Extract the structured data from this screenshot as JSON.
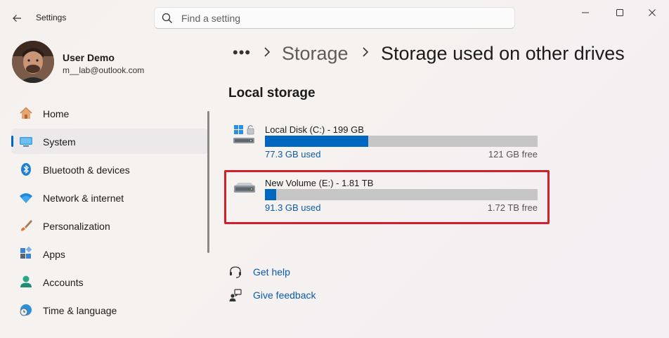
{
  "app": {
    "title": "Settings"
  },
  "search": {
    "placeholder": "Find a setting"
  },
  "user": {
    "name": "User Demo",
    "email": "m__lab@outlook.com"
  },
  "sidebar": {
    "items": [
      {
        "label": "Home",
        "icon": "home-icon"
      },
      {
        "label": "System",
        "icon": "system-icon",
        "active": true
      },
      {
        "label": "Bluetooth & devices",
        "icon": "bluetooth-icon"
      },
      {
        "label": "Network & internet",
        "icon": "wifi-icon"
      },
      {
        "label": "Personalization",
        "icon": "brush-icon"
      },
      {
        "label": "Apps",
        "icon": "apps-icon"
      },
      {
        "label": "Accounts",
        "icon": "account-icon"
      },
      {
        "label": "Time & language",
        "icon": "clock-globe-icon"
      }
    ]
  },
  "breadcrumb": {
    "more": "•••",
    "parent": "Storage",
    "current": "Storage used on other drives"
  },
  "section": {
    "title": "Local storage"
  },
  "drives": [
    {
      "name": "Local Disk (C:) - 199 GB",
      "used": "77.3 GB used",
      "free": "121 GB free",
      "used_fraction": 0.38
    },
    {
      "name": "New Volume (E:) - 1.81 TB",
      "used": "91.3 GB used",
      "free": "1.72 TB free",
      "used_fraction": 0.04
    }
  ],
  "help": {
    "get_help": "Get help",
    "give_feedback": "Give feedback"
  },
  "colors": {
    "accent": "#0067c0",
    "highlight": "#d0202c"
  }
}
